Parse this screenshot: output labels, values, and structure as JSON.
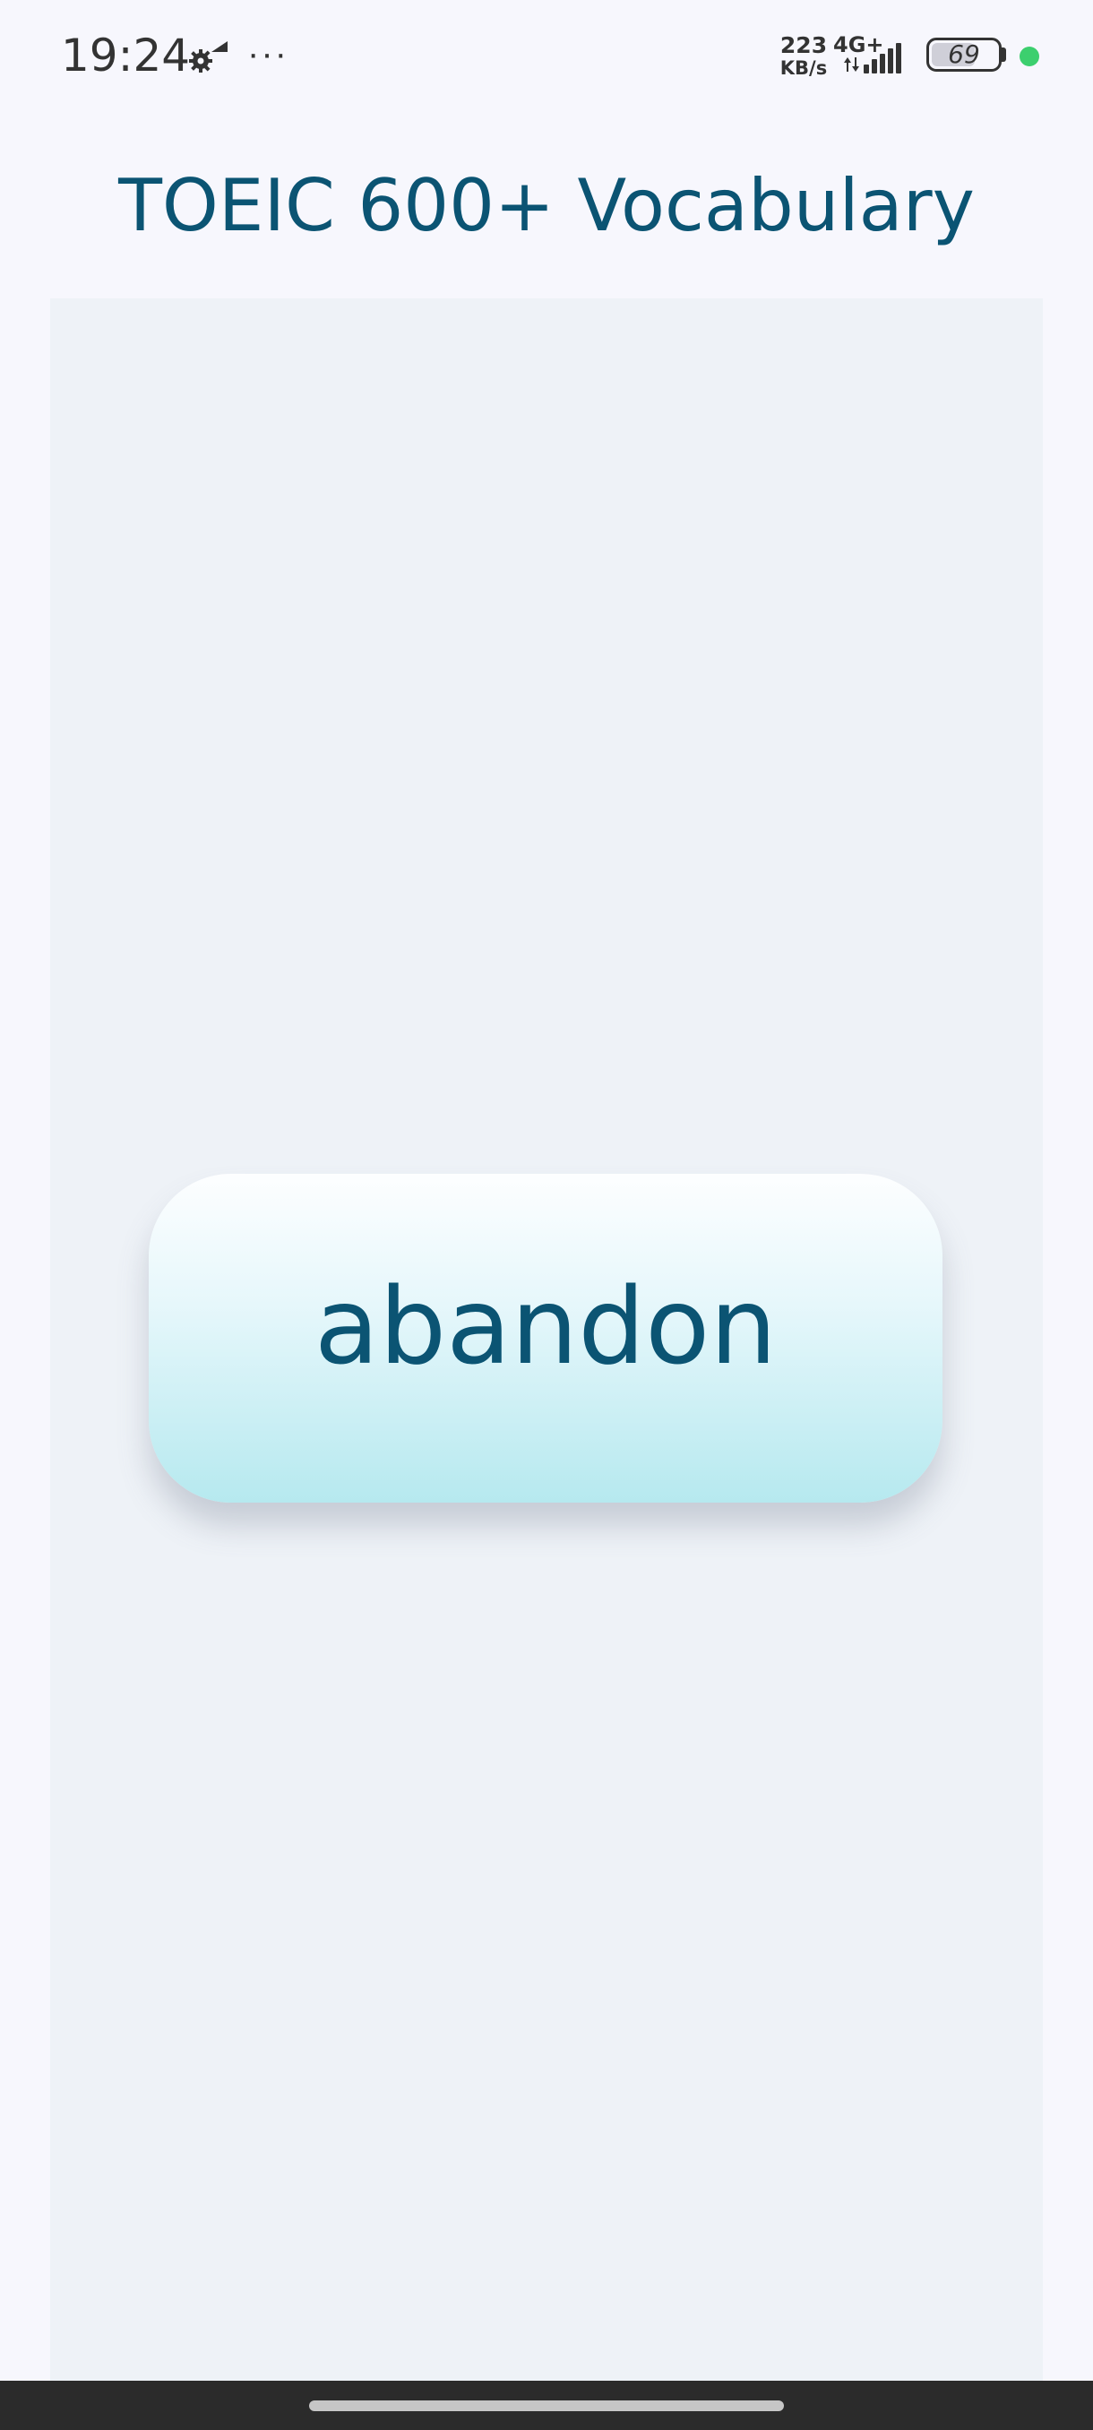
{
  "status_bar": {
    "time": "19:24",
    "settings_icon": "gear-icon",
    "more_indicator": "···",
    "net_speed_value": "223",
    "net_speed_unit": "KB/s",
    "network_type": "4G+",
    "battery_level": "69",
    "battery_fraction": 0.69,
    "dot_color": "#3ccf6e"
  },
  "app": {
    "title": "TOEIC 600+ Vocabulary",
    "title_color": "#0b5473"
  },
  "flashcard": {
    "word": "abandon"
  },
  "nav_bar": {
    "home_indicator": "home-indicator"
  }
}
